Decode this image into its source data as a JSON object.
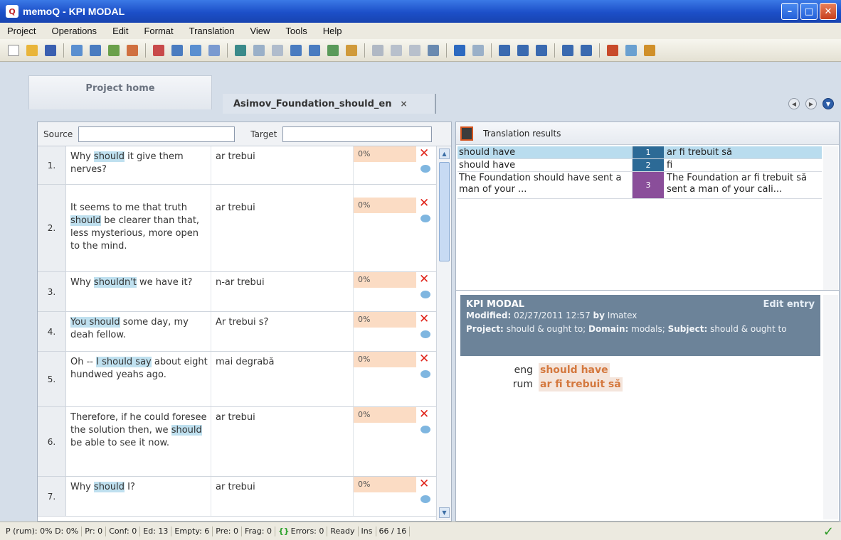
{
  "window": {
    "app": "memoQ",
    "title": "memoQ - KPI MODAL"
  },
  "menu": [
    "Project",
    "Operations",
    "Edit",
    "Format",
    "Translation",
    "View",
    "Tools",
    "Help"
  ],
  "tabs": {
    "home": "Project home",
    "document": "Asimov_Foundation_should_en",
    "document_close": "×"
  },
  "filter": {
    "source_label": "Source",
    "target_label": "Target",
    "source_value": "",
    "target_value": ""
  },
  "segments": [
    {
      "num": "1.",
      "src_pre": "Why ",
      "src_hl": "should",
      "src_post": " it give them nerves?",
      "target": "ar trebui",
      "match": "0%"
    },
    {
      "num": "2.",
      "src_pre": "It seems to me that truth ",
      "src_hl": "should",
      "src_post": " be clearer than that, less mysterious, more open to the mind.",
      "target": "ar trebui",
      "match": "0%"
    },
    {
      "num": "3.",
      "src_pre": "Why ",
      "src_hl": "shouldn't",
      "src_post": " we have it?",
      "target": "n-ar trebui",
      "match": "0%"
    },
    {
      "num": "4.",
      "src_pre": "",
      "src_hl": "You should",
      "src_post": " some day, my deah fellow.",
      "target": "Ar trebui s?",
      "match": "0%"
    },
    {
      "num": "5.",
      "src_pre": "Oh -- ",
      "src_hl": "I should say",
      "src_post": " about eight hundwed yeahs ago.",
      "target": "mai degrabă",
      "match": "0%"
    },
    {
      "num": "6.",
      "src_pre": "Therefore, if he could foresee the solution then, we ",
      "src_hl": "should",
      "src_post": " be able to see it now.",
      "target": "ar trebui",
      "match": "0%"
    },
    {
      "num": "7.",
      "src_pre": "Why ",
      "src_hl": "should",
      "src_post": " I?",
      "target": "ar trebui",
      "match": "0%"
    }
  ],
  "translation_results": {
    "heading": "Translation results",
    "rows": [
      {
        "source": "should have",
        "num": "1",
        "target": "ar fi trebuit să",
        "selected": true
      },
      {
        "source": "should have",
        "num": "2",
        "target": "fi",
        "selected": false
      },
      {
        "source": "The Foundation should have sent a man of your ...",
        "num": "3",
        "target": "The Foundation ar fi trebuit să sent a man of your cali...",
        "selected": false
      }
    ]
  },
  "kpi": {
    "title": "KPI MODAL",
    "edit_label": "Edit entry",
    "modified_label": "Modified:",
    "modified_value": "02/27/2011 12:57",
    "by_label": "by",
    "by_value": "Imatex",
    "project_label": "Project:",
    "project_value": "should & ought to;",
    "domain_label": "Domain:",
    "domain_value": "modals;",
    "subject_label": "Subject:",
    "subject_value": "should & ought to",
    "terms": [
      {
        "lang": "eng",
        "term": "should have"
      },
      {
        "lang": "rum",
        "term": "ar fi trebuit să"
      }
    ]
  },
  "status": {
    "progress": "P (rum): 0%  D: 0%",
    "pr": "Pr: 0",
    "conf": "Conf: 0",
    "ed": "Ed: 13",
    "empty": "Empty: 6",
    "pre": "Pre: 0",
    "frag": "Frag: 0",
    "errors": "Errors: 0",
    "ready": "Ready",
    "ins": "Ins",
    "pos": "66 / 16"
  },
  "colors": {
    "titlebar": "#1c4fc8",
    "highlight": "#bfe0ef",
    "match": "#fbdcc4",
    "kpi_header": "#6c8399",
    "term": "#d4783e"
  }
}
